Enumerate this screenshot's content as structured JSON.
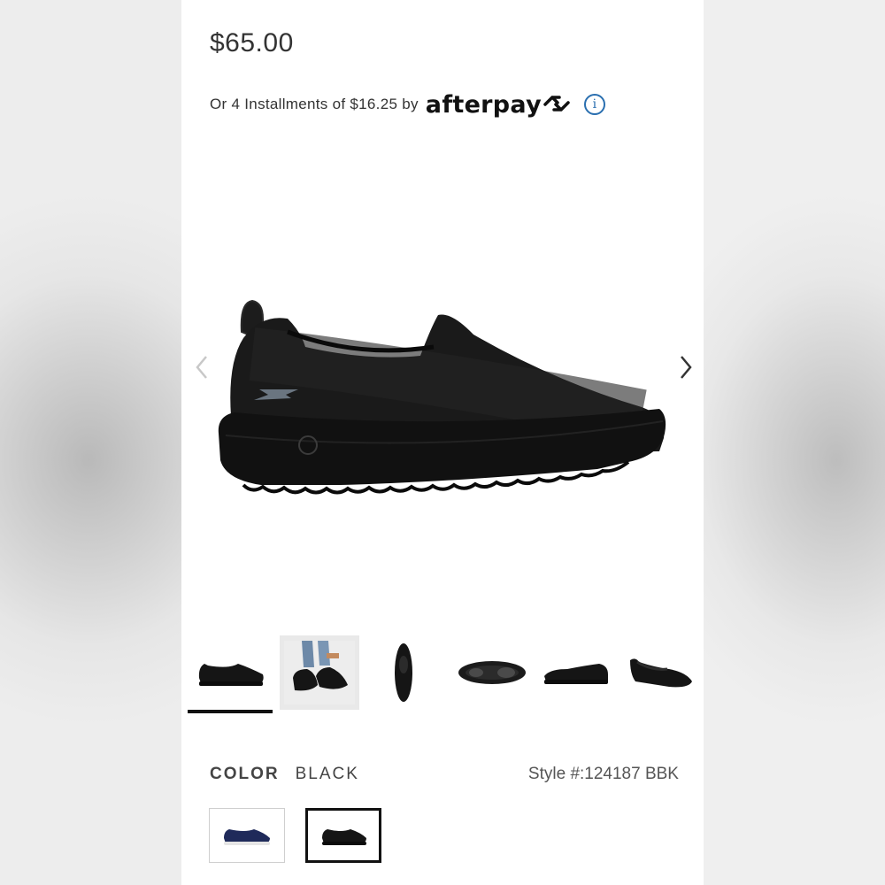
{
  "product": {
    "price": "$65.00",
    "installment_text": "Or 4 Installments of $16.25 by",
    "afterpay_brand": "afterpay",
    "info_icon": "info-icon"
  },
  "gallery": {
    "prev_icon": "chevron-left-icon",
    "next_icon": "chevron-right-icon",
    "thumbnails": [
      {
        "name": "thumb-side-view",
        "selected": true
      },
      {
        "name": "thumb-on-feet",
        "selected": false
      },
      {
        "name": "thumb-top-view",
        "selected": false
      },
      {
        "name": "thumb-sole-view",
        "selected": false
      },
      {
        "name": "thumb-inner-side",
        "selected": false
      },
      {
        "name": "thumb-angle-view",
        "selected": false
      }
    ]
  },
  "color": {
    "label": "COLOR",
    "value": "BLACK",
    "style_number": "Style #:124187 BBK",
    "swatches": [
      {
        "name": "navy",
        "color": "#1f2a5a",
        "selected": false
      },
      {
        "name": "black",
        "color": "#111111",
        "selected": true
      }
    ]
  },
  "colors": {
    "info_blue": "#2a6fb0",
    "text_dark": "#333333",
    "shoe_black": "#161616"
  }
}
